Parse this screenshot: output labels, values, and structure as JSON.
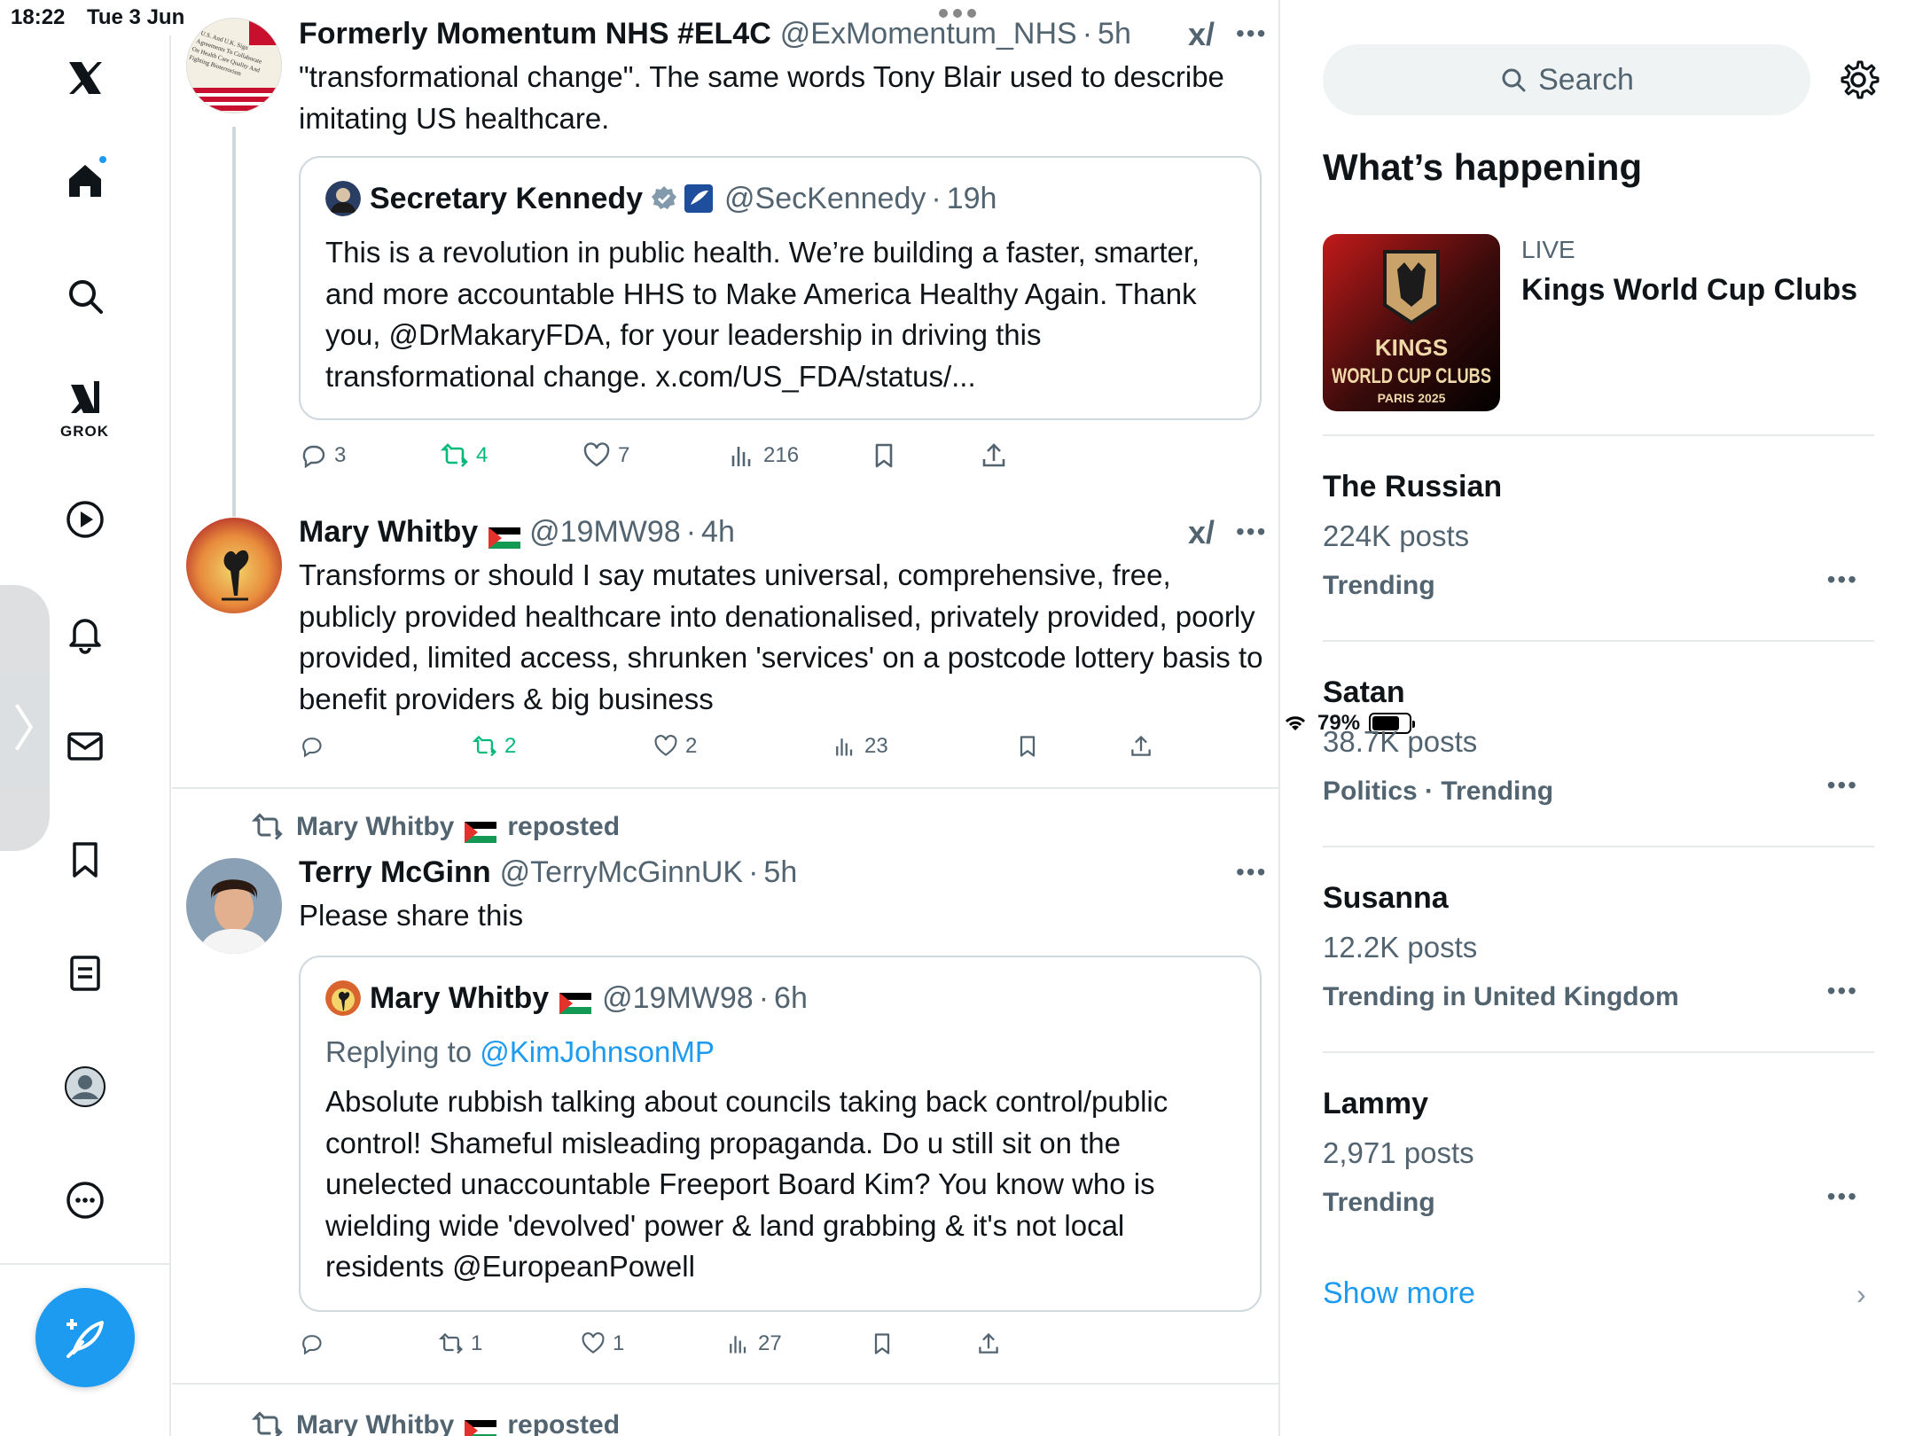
{
  "status": {
    "time": "18:22",
    "date": "Tue 3 Jun",
    "battery": "79%"
  },
  "nav": {
    "grok_label": "GROK",
    "items": [
      "x-logo",
      "home",
      "explore",
      "grok",
      "video",
      "notifications",
      "messages",
      "bookmarks",
      "lists",
      "profile",
      "more"
    ]
  },
  "posts": [
    {
      "name": "Formerly Momentum NHS #EL4C",
      "handle": "@ExMomentum_NHS",
      "sep": "·",
      "time": "5h",
      "text": "\"transformational change\". The same words Tony Blair used to describe imitating US healthcare.",
      "avatar_text": "U.S. And U.K. Sign Agreements To Collaborate On Health Care Quality And Fighting Bioterrorism",
      "quote": {
        "name": "Secretary Kennedy",
        "handle": "@SecKennedy",
        "sep": "·",
        "time": "19h",
        "text": "This is a revolution in public health. We’re building a faster, smarter, and more accountable HHS to Make America Healthy Again. Thank you, @DrMakaryFDA, for your leadership in driving this transformational change. x.com/US_FDA/status/..."
      },
      "replies": "3",
      "reposts": "4",
      "likes": "7",
      "views": "216"
    },
    {
      "name": "Mary Whitby",
      "handle": "@19MW98",
      "sep": "·",
      "time": "4h",
      "text": "Transforms or should I say mutates universal, comprehensive, free, publicly provided healthcare into denationalised, privately provided, poorly provided, limited access, shrunken 'services' on a postcode lottery basis to benefit providers & big business",
      "replies": "",
      "reposts": "2",
      "likes": "2",
      "views": "23"
    },
    {
      "repost_by": "Mary Whitby",
      "repost_label": "reposted",
      "name": "Terry McGinn",
      "handle": "@TerryMcGinnUK",
      "sep": "·",
      "time": "5h",
      "text": "Please share this",
      "quote": {
        "name": "Mary Whitby",
        "handle": "@19MW98",
        "sep": "·",
        "time": "6h",
        "reply_prefix": "Replying to",
        "reply_to": "@KimJohnsonMP",
        "text": "Absolute rubbish talking about councils taking back control/public control! Shameful misleading propaganda. Do u still sit on the unelected unaccountable Freeport Board Kim? You know who is wielding wide 'devolved' power & land grabbing & it's not local residents @EuropeanPowell"
      },
      "replies": "",
      "reposts": "1",
      "likes": "1",
      "views": "27"
    },
    {
      "repost_by": "Mary Whitby",
      "repost_label": "reposted"
    }
  ],
  "sidebar": {
    "search_placeholder": "Search",
    "heading": "What’s happening",
    "live": {
      "label": "LIVE",
      "title": "Kings World Cup Clubs",
      "logo_line1": "KINGS",
      "logo_line2": "WORLD CUP CLUBS",
      "logo_line3": "PARIS 2025"
    },
    "trends": [
      {
        "title": "The Russian",
        "count": "224K posts",
        "meta": "Trending"
      },
      {
        "title": "Satan",
        "count": "38.7K posts",
        "meta": "Politics · Trending"
      },
      {
        "title": "Susanna",
        "count": "12.2K posts",
        "meta": "Trending in United Kingdom"
      },
      {
        "title": "Lammy",
        "count": "2,971 posts",
        "meta": "Trending"
      }
    ],
    "show_more": "Show more"
  },
  "colors": {
    "accent": "#1d9bf0",
    "repost_green": "#00ba7c",
    "muted": "#536471"
  }
}
